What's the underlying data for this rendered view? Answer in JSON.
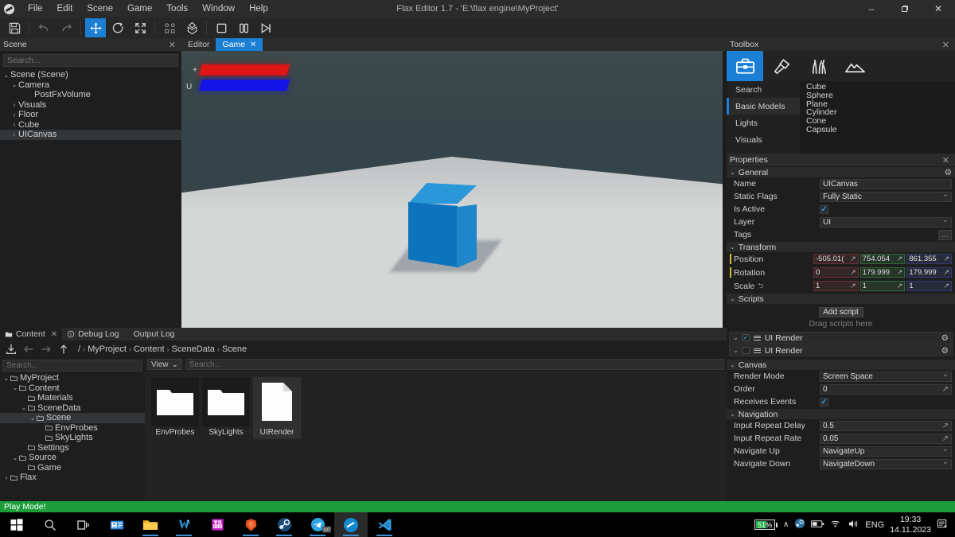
{
  "window": {
    "title": "Flax Editor 1.7 - 'E:\\flax engine\\MyProject'",
    "minimize": "–",
    "maximize": "❐",
    "close": "✕",
    "logo_name": "flax-logo"
  },
  "menubar": {
    "items": [
      "File",
      "Edit",
      "Scene",
      "Game",
      "Tools",
      "Window",
      "Help"
    ]
  },
  "toolbar": {
    "buttons": [
      {
        "name": "save-button",
        "icon": "save-icon"
      },
      {
        "name": "undo-button",
        "icon": "undo-icon"
      },
      {
        "name": "redo-button",
        "icon": "redo-icon"
      },
      {
        "name": "translate-gizmo-button",
        "icon": "move-icon",
        "active": true
      },
      {
        "name": "rotate-gizmo-button",
        "icon": "rotate-icon"
      },
      {
        "name": "scale-gizmo-button",
        "icon": "scale-icon"
      },
      {
        "name": "pivot-button",
        "icon": "pivot-icon"
      },
      {
        "name": "build-button",
        "icon": "build-icon"
      },
      {
        "name": "stop-button",
        "icon": "stop-icon"
      },
      {
        "name": "pause-button",
        "icon": "pause-icon"
      },
      {
        "name": "step-button",
        "icon": "step-icon"
      }
    ]
  },
  "scene_panel": {
    "title": "Scene",
    "close": "✕",
    "search_placeholder": "Search...",
    "tree": [
      {
        "label": "Scene (Scene)",
        "depth": 0,
        "arrow": "⌄",
        "selected": false
      },
      {
        "label": "Camera",
        "depth": 1,
        "arrow": "⌄",
        "selected": false
      },
      {
        "label": "PostFxVolume",
        "depth": 3,
        "arrow": "",
        "selected": false
      },
      {
        "label": "Visuals",
        "depth": 1,
        "arrow": "›",
        "selected": false
      },
      {
        "label": "Floor",
        "depth": 1,
        "arrow": "›",
        "selected": false
      },
      {
        "label": "Cube",
        "depth": 1,
        "arrow": "›",
        "selected": false
      },
      {
        "label": "UICanvas",
        "depth": 1,
        "arrow": "›",
        "selected": true
      }
    ]
  },
  "viewport": {
    "tabs": [
      {
        "label": "Editor",
        "active": false,
        "closable": false
      },
      {
        "label": "Game",
        "active": true,
        "closable": true,
        "close": "✕"
      }
    ],
    "overlay_labels": {
      "plus": "+",
      "u": "U"
    }
  },
  "content_panel": {
    "tabs": [
      {
        "label": "Content",
        "active": true,
        "icon": "folder-icon",
        "close": "✕"
      },
      {
        "label": "Debug Log",
        "active": false,
        "icon": "info-icon"
      },
      {
        "label": "Output Log",
        "active": false,
        "icon": ""
      }
    ],
    "nav": {
      "import_icon": "import-icon",
      "back_icon": "arrow-left-icon",
      "forward_icon": "arrow-right-icon",
      "up_icon": "arrow-up-icon",
      "root": "/",
      "breadcrumbs": [
        "MyProject",
        "Content",
        "SceneData",
        "Scene"
      ],
      "separator": "›"
    },
    "tree_search_placeholder": "Search...",
    "tree": [
      {
        "label": "MyProject",
        "depth": 0,
        "arrow": "⌄",
        "selected": false
      },
      {
        "label": "Content",
        "depth": 1,
        "arrow": "⌄",
        "selected": false
      },
      {
        "label": "Materials",
        "depth": 2,
        "arrow": "",
        "selected": false
      },
      {
        "label": "SceneData",
        "depth": 2,
        "arrow": "⌄",
        "selected": false
      },
      {
        "label": "Scene",
        "depth": 3,
        "arrow": "⌄",
        "selected": true
      },
      {
        "label": "EnvProbes",
        "depth": 4,
        "arrow": "",
        "selected": false
      },
      {
        "label": "SkyLights",
        "depth": 4,
        "arrow": "",
        "selected": false
      },
      {
        "label": "Settings",
        "depth": 2,
        "arrow": "",
        "selected": false
      },
      {
        "label": "Source",
        "depth": 1,
        "arrow": "⌄",
        "selected": false
      },
      {
        "label": "Game",
        "depth": 2,
        "arrow": "",
        "selected": false
      },
      {
        "label": "Flax",
        "depth": 0,
        "arrow": "›",
        "selected": false
      }
    ],
    "view_button": "View",
    "view_chevron": "⌄",
    "item_search_placeholder": "Search...",
    "items": [
      {
        "label": "EnvProbes",
        "type": "folder",
        "selected": false
      },
      {
        "label": "SkyLights",
        "type": "folder",
        "selected": false
      },
      {
        "label": "UIRender",
        "type": "script",
        "selected": true,
        "glyph": "</>"
      }
    ]
  },
  "toolbox": {
    "title": "Toolbox",
    "close": "✕",
    "tabs": [
      {
        "name": "toolbox-spawn-icon",
        "active": true
      },
      {
        "name": "paint-icon",
        "active": false
      },
      {
        "name": "foliage-icon",
        "active": false
      },
      {
        "name": "terrain-icon",
        "active": false
      }
    ],
    "categories": [
      {
        "label": "Search",
        "active": false
      },
      {
        "label": "Basic Models",
        "active": true
      },
      {
        "label": "Lights",
        "active": false
      },
      {
        "label": "Visuals",
        "active": false
      }
    ],
    "items": [
      "Cube",
      "Sphere",
      "Plane",
      "Cylinder",
      "Cone",
      "Capsule"
    ]
  },
  "properties": {
    "title": "Properties",
    "close": "✕",
    "chevron": "⌄",
    "gear": "⚙",
    "expand_icon": "↗",
    "sections": {
      "general": {
        "title": "General",
        "name": {
          "label": "Name",
          "value": "UICanvas"
        },
        "static_flags": {
          "label": "Static Flags",
          "value": "Fully Static"
        },
        "is_active": {
          "label": "Is Active",
          "checked": true,
          "check": "✓"
        },
        "layer": {
          "label": "Layer",
          "value": "UI"
        },
        "tags": {
          "label": "Tags",
          "value": "",
          "button": "…"
        }
      },
      "transform": {
        "title": "Transform",
        "position": {
          "label": "Position",
          "x": "-505.01(",
          "y": "754.054",
          "z": "861.355"
        },
        "rotation": {
          "label": "Rotation",
          "x": "0",
          "y": "179.999",
          "z": "179.999"
        },
        "scale": {
          "label": "Scale",
          "x": "1",
          "y": "1",
          "z": "1",
          "link": "⮌"
        }
      },
      "scripts": {
        "title": "Scripts",
        "add_button": "Add script",
        "drag_hint": "Drag scripts here",
        "rows": [
          {
            "label": "UI Render",
            "checked": true,
            "check": "✓"
          },
          {
            "label": "UI Render",
            "checked": false,
            "check": ""
          }
        ]
      },
      "canvas": {
        "title": "Canvas",
        "render_mode": {
          "label": "Render Mode",
          "value": "Screen Space"
        },
        "order": {
          "label": "Order",
          "value": "0"
        },
        "receives_events": {
          "label": "Receives Events",
          "checked": true,
          "check": "✓"
        }
      },
      "navigation": {
        "title": "Navigation",
        "input_repeat_delay": {
          "label": "Input Repeat Delay",
          "value": "0.5"
        },
        "input_repeat_rate": {
          "label": "Input Repeat Rate",
          "value": "0.05"
        },
        "navigate_up": {
          "label": "Navigate Up",
          "value": "NavigateUp"
        },
        "navigate_down": {
          "label": "Navigate Down",
          "value": "NavigateDown"
        }
      }
    }
  },
  "statusbar": {
    "play_mode": "Play Mode!"
  },
  "taskbar": {
    "items": [
      {
        "name": "start-button",
        "icon": "windows-icon"
      },
      {
        "name": "search-button",
        "icon": "search-icon"
      },
      {
        "name": "task-view-button",
        "icon": "task-view-icon"
      },
      {
        "name": "taskbar-app-news",
        "icon": "news-icon",
        "open": false,
        "running": false
      },
      {
        "name": "taskbar-app-explorer",
        "icon": "folder-icon",
        "open": false,
        "running": true
      },
      {
        "name": "taskbar-app-wallpaper",
        "icon": "wallpaper-icon",
        "open": false,
        "running": true
      },
      {
        "name": "taskbar-app-purple",
        "icon": "purple-app-icon",
        "open": false,
        "running": false
      },
      {
        "name": "taskbar-app-brave",
        "icon": "brave-icon",
        "open": false,
        "running": true
      },
      {
        "name": "taskbar-app-steam",
        "icon": "steam-icon",
        "open": false,
        "running": true
      },
      {
        "name": "taskbar-app-telegram",
        "icon": "telegram-icon",
        "open": false,
        "running": true,
        "badge": "107"
      },
      {
        "name": "taskbar-app-flax",
        "icon": "flax-icon",
        "open": true,
        "running": true
      },
      {
        "name": "taskbar-app-vscode",
        "icon": "vscode-icon",
        "open": false,
        "running": true
      }
    ],
    "tray": {
      "battery_percent": "51%",
      "chevron": "∧",
      "steam_icon": "steam-tray-icon",
      "battery_icon": "battery-icon",
      "wifi_icon": "wifi-icon",
      "volume_icon": "volume-icon",
      "language": "ENG",
      "time": "19:33",
      "date": "14.11.2023",
      "notifications_icon": "notifications-icon"
    }
  },
  "colors": {
    "accent": "#1b7fd4",
    "play_mode": "#1e9e3a",
    "axis_x": "#6b2f34",
    "axis_y": "#2f6b35",
    "axis_z": "#343a78",
    "cube": "#0d73bd",
    "ui_red": "#e01515",
    "ui_blue": "#1414e8"
  }
}
